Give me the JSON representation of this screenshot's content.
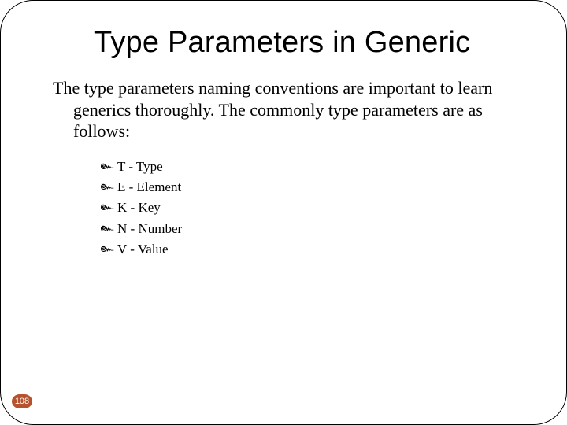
{
  "title": "Type Parameters in Generic",
  "intro": "The type parameters naming conventions are important to learn generics thoroughly. The commonly type parameters are as follows:",
  "items": [
    "T - Type",
    "E - Element",
    "K - Key",
    "N - Number",
    "V - Value"
  ],
  "bullet_glyph": "๛",
  "page_number": "108"
}
